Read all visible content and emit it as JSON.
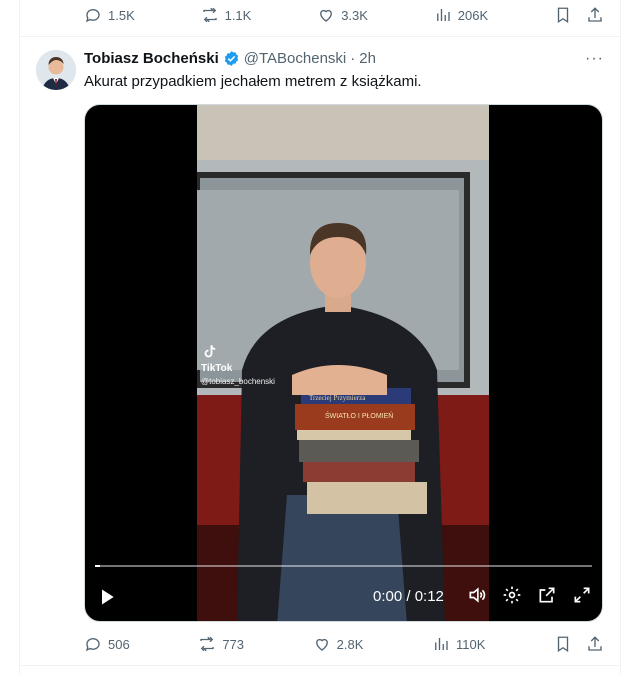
{
  "top_actions": {
    "replies": "1.5K",
    "reposts": "1.1K",
    "likes": "3.3K",
    "views": "206K"
  },
  "tweet": {
    "name": "Tobiasz Bocheński",
    "handle": "@TABochenski",
    "separator": "·",
    "time": "2h",
    "more": "···",
    "text": "Akurat przypadkiem jechałem metrem z książkami.",
    "verified_color": "#1d9bf0"
  },
  "video": {
    "watermark": "TikTok",
    "watermark_user": "@tobiasz_bochenski",
    "book_titles": [
      "Trzeciej Przymierza",
      "ŚWIATŁO I PŁOMIEŃ"
    ],
    "time_readout": "0:00 / 0:12",
    "progress": 0.01
  },
  "bottom_actions": {
    "replies": "506",
    "reposts": "773",
    "likes": "2.8K",
    "views": "110K"
  }
}
